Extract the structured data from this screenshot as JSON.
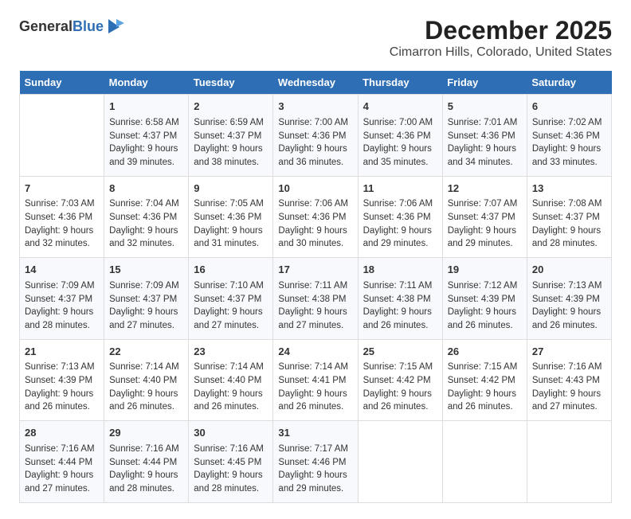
{
  "logo": {
    "general": "General",
    "blue": "Blue"
  },
  "title": "December 2025",
  "subtitle": "Cimarron Hills, Colorado, United States",
  "calendar": {
    "headers": [
      "Sunday",
      "Monday",
      "Tuesday",
      "Wednesday",
      "Thursday",
      "Friday",
      "Saturday"
    ],
    "weeks": [
      [
        {
          "day": "",
          "sunrise": "",
          "sunset": "",
          "daylight": ""
        },
        {
          "day": "1",
          "sunrise": "Sunrise: 6:58 AM",
          "sunset": "Sunset: 4:37 PM",
          "daylight": "Daylight: 9 hours and 39 minutes."
        },
        {
          "day": "2",
          "sunrise": "Sunrise: 6:59 AM",
          "sunset": "Sunset: 4:37 PM",
          "daylight": "Daylight: 9 hours and 38 minutes."
        },
        {
          "day": "3",
          "sunrise": "Sunrise: 7:00 AM",
          "sunset": "Sunset: 4:36 PM",
          "daylight": "Daylight: 9 hours and 36 minutes."
        },
        {
          "day": "4",
          "sunrise": "Sunrise: 7:00 AM",
          "sunset": "Sunset: 4:36 PM",
          "daylight": "Daylight: 9 hours and 35 minutes."
        },
        {
          "day": "5",
          "sunrise": "Sunrise: 7:01 AM",
          "sunset": "Sunset: 4:36 PM",
          "daylight": "Daylight: 9 hours and 34 minutes."
        },
        {
          "day": "6",
          "sunrise": "Sunrise: 7:02 AM",
          "sunset": "Sunset: 4:36 PM",
          "daylight": "Daylight: 9 hours and 33 minutes."
        }
      ],
      [
        {
          "day": "7",
          "sunrise": "Sunrise: 7:03 AM",
          "sunset": "Sunset: 4:36 PM",
          "daylight": "Daylight: 9 hours and 32 minutes."
        },
        {
          "day": "8",
          "sunrise": "Sunrise: 7:04 AM",
          "sunset": "Sunset: 4:36 PM",
          "daylight": "Daylight: 9 hours and 32 minutes."
        },
        {
          "day": "9",
          "sunrise": "Sunrise: 7:05 AM",
          "sunset": "Sunset: 4:36 PM",
          "daylight": "Daylight: 9 hours and 31 minutes."
        },
        {
          "day": "10",
          "sunrise": "Sunrise: 7:06 AM",
          "sunset": "Sunset: 4:36 PM",
          "daylight": "Daylight: 9 hours and 30 minutes."
        },
        {
          "day": "11",
          "sunrise": "Sunrise: 7:06 AM",
          "sunset": "Sunset: 4:36 PM",
          "daylight": "Daylight: 9 hours and 29 minutes."
        },
        {
          "day": "12",
          "sunrise": "Sunrise: 7:07 AM",
          "sunset": "Sunset: 4:37 PM",
          "daylight": "Daylight: 9 hours and 29 minutes."
        },
        {
          "day": "13",
          "sunrise": "Sunrise: 7:08 AM",
          "sunset": "Sunset: 4:37 PM",
          "daylight": "Daylight: 9 hours and 28 minutes."
        }
      ],
      [
        {
          "day": "14",
          "sunrise": "Sunrise: 7:09 AM",
          "sunset": "Sunset: 4:37 PM",
          "daylight": "Daylight: 9 hours and 28 minutes."
        },
        {
          "day": "15",
          "sunrise": "Sunrise: 7:09 AM",
          "sunset": "Sunset: 4:37 PM",
          "daylight": "Daylight: 9 hours and 27 minutes."
        },
        {
          "day": "16",
          "sunrise": "Sunrise: 7:10 AM",
          "sunset": "Sunset: 4:37 PM",
          "daylight": "Daylight: 9 hours and 27 minutes."
        },
        {
          "day": "17",
          "sunrise": "Sunrise: 7:11 AM",
          "sunset": "Sunset: 4:38 PM",
          "daylight": "Daylight: 9 hours and 27 minutes."
        },
        {
          "day": "18",
          "sunrise": "Sunrise: 7:11 AM",
          "sunset": "Sunset: 4:38 PM",
          "daylight": "Daylight: 9 hours and 26 minutes."
        },
        {
          "day": "19",
          "sunrise": "Sunrise: 7:12 AM",
          "sunset": "Sunset: 4:39 PM",
          "daylight": "Daylight: 9 hours and 26 minutes."
        },
        {
          "day": "20",
          "sunrise": "Sunrise: 7:13 AM",
          "sunset": "Sunset: 4:39 PM",
          "daylight": "Daylight: 9 hours and 26 minutes."
        }
      ],
      [
        {
          "day": "21",
          "sunrise": "Sunrise: 7:13 AM",
          "sunset": "Sunset: 4:39 PM",
          "daylight": "Daylight: 9 hours and 26 minutes."
        },
        {
          "day": "22",
          "sunrise": "Sunrise: 7:14 AM",
          "sunset": "Sunset: 4:40 PM",
          "daylight": "Daylight: 9 hours and 26 minutes."
        },
        {
          "day": "23",
          "sunrise": "Sunrise: 7:14 AM",
          "sunset": "Sunset: 4:40 PM",
          "daylight": "Daylight: 9 hours and 26 minutes."
        },
        {
          "day": "24",
          "sunrise": "Sunrise: 7:14 AM",
          "sunset": "Sunset: 4:41 PM",
          "daylight": "Daylight: 9 hours and 26 minutes."
        },
        {
          "day": "25",
          "sunrise": "Sunrise: 7:15 AM",
          "sunset": "Sunset: 4:42 PM",
          "daylight": "Daylight: 9 hours and 26 minutes."
        },
        {
          "day": "26",
          "sunrise": "Sunrise: 7:15 AM",
          "sunset": "Sunset: 4:42 PM",
          "daylight": "Daylight: 9 hours and 26 minutes."
        },
        {
          "day": "27",
          "sunrise": "Sunrise: 7:16 AM",
          "sunset": "Sunset: 4:43 PM",
          "daylight": "Daylight: 9 hours and 27 minutes."
        }
      ],
      [
        {
          "day": "28",
          "sunrise": "Sunrise: 7:16 AM",
          "sunset": "Sunset: 4:44 PM",
          "daylight": "Daylight: 9 hours and 27 minutes."
        },
        {
          "day": "29",
          "sunrise": "Sunrise: 7:16 AM",
          "sunset": "Sunset: 4:44 PM",
          "daylight": "Daylight: 9 hours and 28 minutes."
        },
        {
          "day": "30",
          "sunrise": "Sunrise: 7:16 AM",
          "sunset": "Sunset: 4:45 PM",
          "daylight": "Daylight: 9 hours and 28 minutes."
        },
        {
          "day": "31",
          "sunrise": "Sunrise: 7:17 AM",
          "sunset": "Sunset: 4:46 PM",
          "daylight": "Daylight: 9 hours and 29 minutes."
        },
        {
          "day": "",
          "sunrise": "",
          "sunset": "",
          "daylight": ""
        },
        {
          "day": "",
          "sunrise": "",
          "sunset": "",
          "daylight": ""
        },
        {
          "day": "",
          "sunrise": "",
          "sunset": "",
          "daylight": ""
        }
      ]
    ]
  }
}
